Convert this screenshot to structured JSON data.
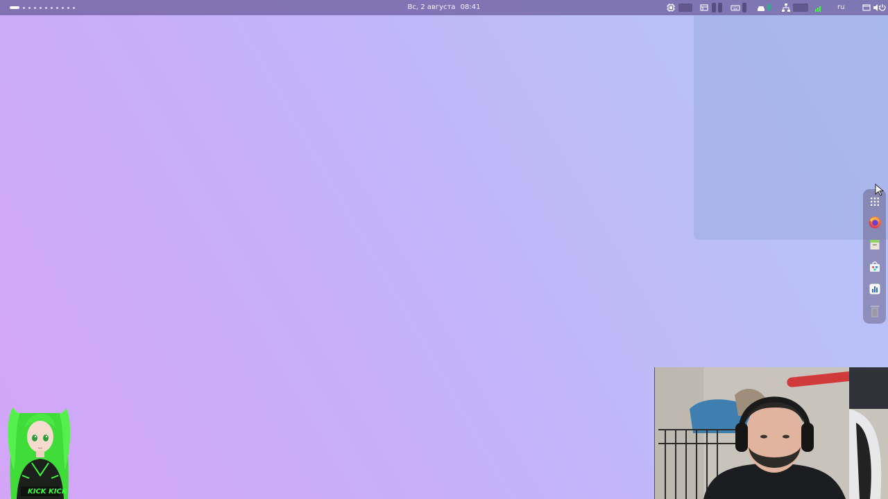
{
  "top_panel": {
    "clock": {
      "day": "Вс, 2 августа",
      "time": "08:41"
    },
    "workspaces": {
      "active_index": 0,
      "count": 11
    },
    "tray_icons": [
      "cpu-icon",
      "window-list-icon",
      "keyboard-icon",
      "storage-icon",
      "network-icon",
      "signal-icon",
      "screen-icon",
      "volume-icon",
      "power-icon"
    ],
    "language": "ru"
  },
  "dock": {
    "items": [
      {
        "name": "app-grid",
        "icon": "app-grid-icon"
      },
      {
        "name": "firefox",
        "icon": "firefox-icon"
      },
      {
        "name": "archive-manager",
        "icon": "archive-icon"
      },
      {
        "name": "software-store",
        "icon": "store-icon"
      },
      {
        "name": "system-monitor",
        "icon": "monitor-chart-icon"
      },
      {
        "name": "trash",
        "icon": "trash-icon"
      }
    ]
  },
  "avatar": {
    "logo_text": "KICK KICK"
  },
  "colors": {
    "accent_green": "#3cff3c",
    "panel": "#7060a0",
    "desktop_start": "#d4a5f7",
    "desktop_end": "#b6c6f8"
  }
}
